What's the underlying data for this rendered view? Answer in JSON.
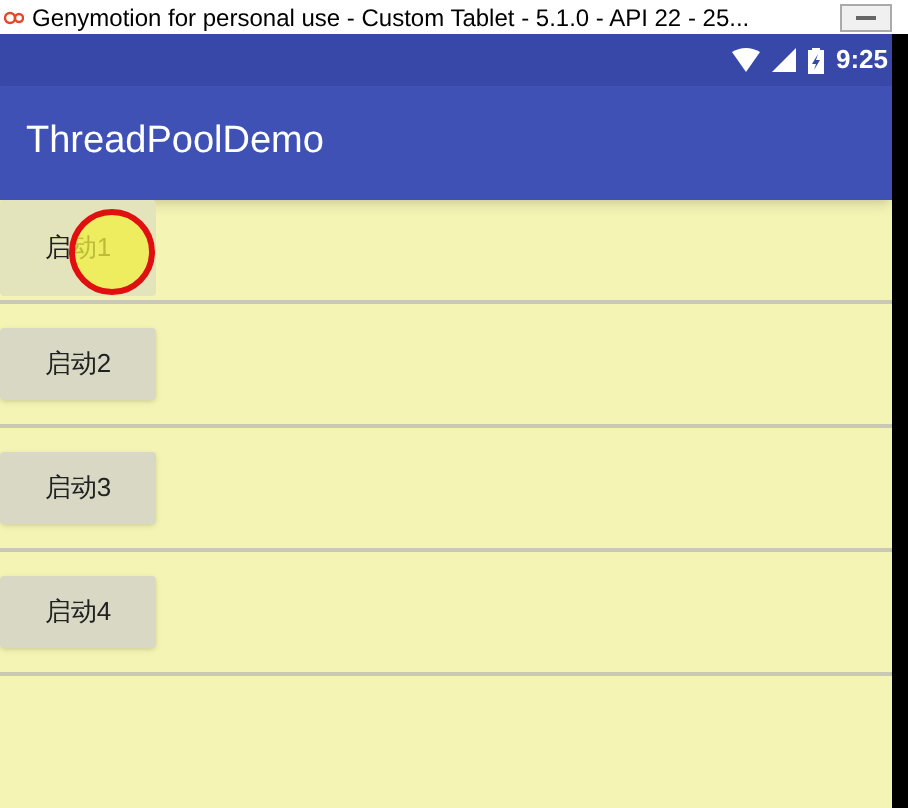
{
  "window": {
    "title": "Genymotion for personal use - Custom Tablet - 5.1.0 - API 22 - 25..."
  },
  "status_bar": {
    "time": "9:25"
  },
  "app_bar": {
    "title": "ThreadPoolDemo"
  },
  "buttons": [
    {
      "label": "启动1",
      "pressed": true
    },
    {
      "label": "启动2",
      "pressed": false
    },
    {
      "label": "启动3",
      "pressed": false
    },
    {
      "label": "启动4",
      "pressed": false
    }
  ]
}
